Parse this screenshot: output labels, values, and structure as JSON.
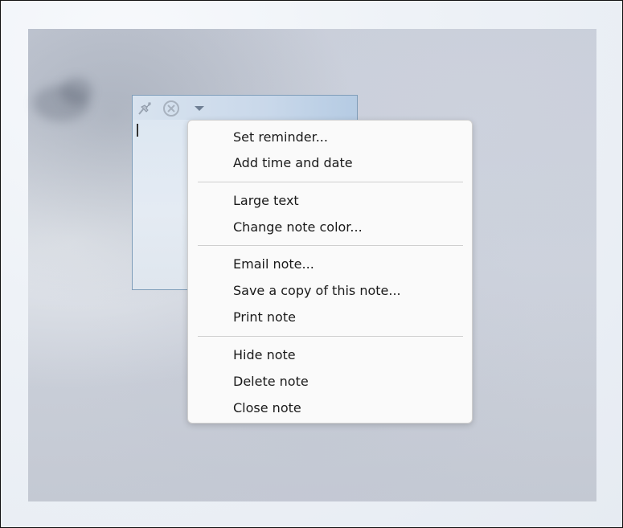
{
  "note": {
    "text": ""
  },
  "icons": {
    "pin": "pin-icon",
    "close": "close-icon",
    "menu": "menu-dropdown-icon"
  },
  "context_menu": {
    "groups": [
      {
        "items": [
          "Set reminder...",
          "Add time and date"
        ]
      },
      {
        "items": [
          "Large text",
          "Change note color..."
        ]
      },
      {
        "items": [
          "Email note...",
          "Save a copy of this note...",
          "Print note"
        ]
      },
      {
        "items": [
          "Hide note",
          "Delete note",
          "Close note"
        ]
      }
    ]
  },
  "colors": {
    "menu_bg": "#fafafa",
    "menu_border": "#cfcfcf",
    "note_border": "#7f9db9"
  }
}
